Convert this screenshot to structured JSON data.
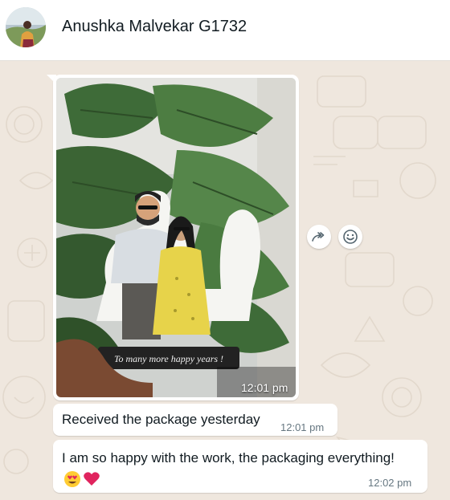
{
  "header": {
    "contact_name": "Anushka Malvekar G1732",
    "avatar_icon": "contact-avatar-photo"
  },
  "image_message": {
    "caption_on_photo": "To many more happy years !",
    "time": "12:01 pm"
  },
  "actions": {
    "forward_icon": "forward-icon",
    "react_icon": "emoji-react-icon"
  },
  "messages": [
    {
      "text": "Received the package yesterday",
      "time": "12:01 pm"
    },
    {
      "text": "I am so happy with the work, the packaging everything!",
      "emojis": [
        "heart-eyes-emoji",
        "red-heart-emoji"
      ],
      "time": "12:02 pm"
    }
  ],
  "colors": {
    "chat_background": "#efe7de",
    "bubble": "#ffffff",
    "timestamp": "#667781"
  }
}
